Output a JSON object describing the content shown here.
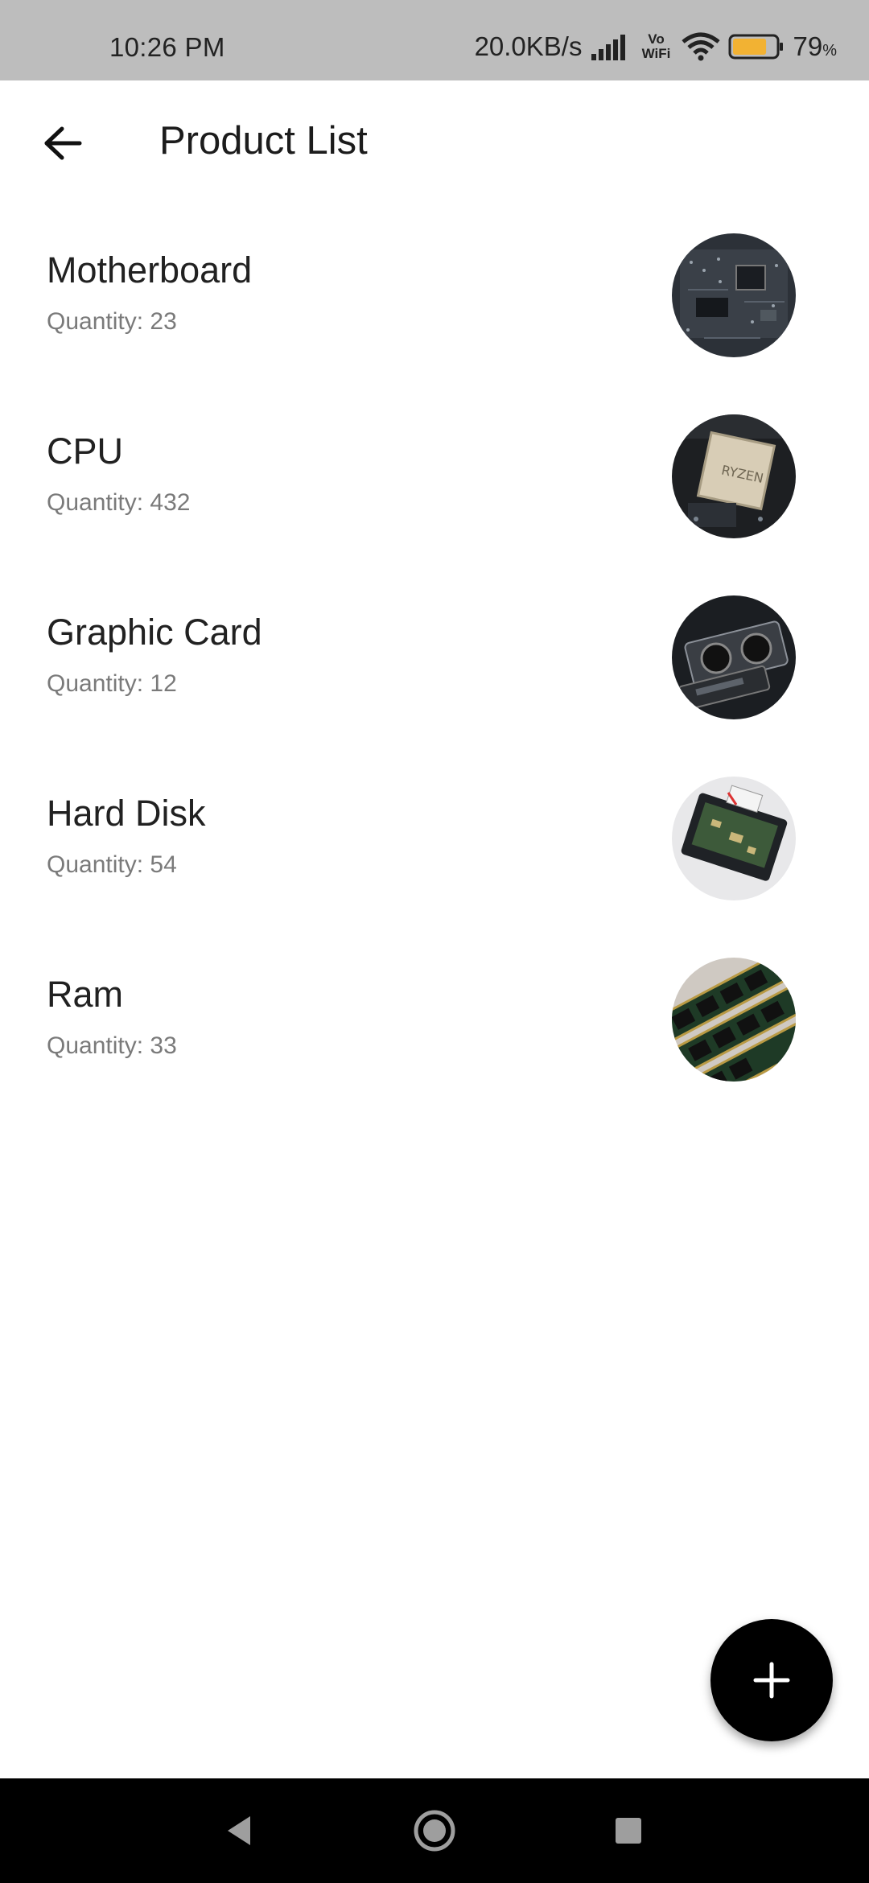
{
  "status_bar": {
    "time": "10:26 PM",
    "net_speed": "20.0KB/s",
    "vowifi_top": "Vo",
    "vowifi_bottom": "WiFi",
    "battery_level": "79",
    "battery_unit": "%",
    "battery_fill": 0.79,
    "battery_color": "#f2b233"
  },
  "app_bar": {
    "title": "Product List",
    "back_icon": "arrow-left-icon"
  },
  "products": [
    {
      "name": "Motherboard",
      "quantity_label": "Quantity: 23",
      "image": "motherboard-image"
    },
    {
      "name": "CPU",
      "quantity_label": "Quantity: 432",
      "image": "cpu-image"
    },
    {
      "name": "Graphic Card",
      "quantity_label": "Quantity: 12",
      "image": "graphic-card-image"
    },
    {
      "name": "Hard Disk",
      "quantity_label": "Quantity: 54",
      "image": "hard-disk-image"
    },
    {
      "name": "Ram",
      "quantity_label": "Quantity: 33",
      "image": "ram-image"
    }
  ],
  "cpu_chip_text": "RYZEN",
  "fab": {
    "icon": "plus-icon",
    "color": "#000000"
  },
  "nav_bar": {
    "back_icon": "triangle-back-icon",
    "home_icon": "circle-home-icon",
    "recents_icon": "square-recents-icon"
  }
}
